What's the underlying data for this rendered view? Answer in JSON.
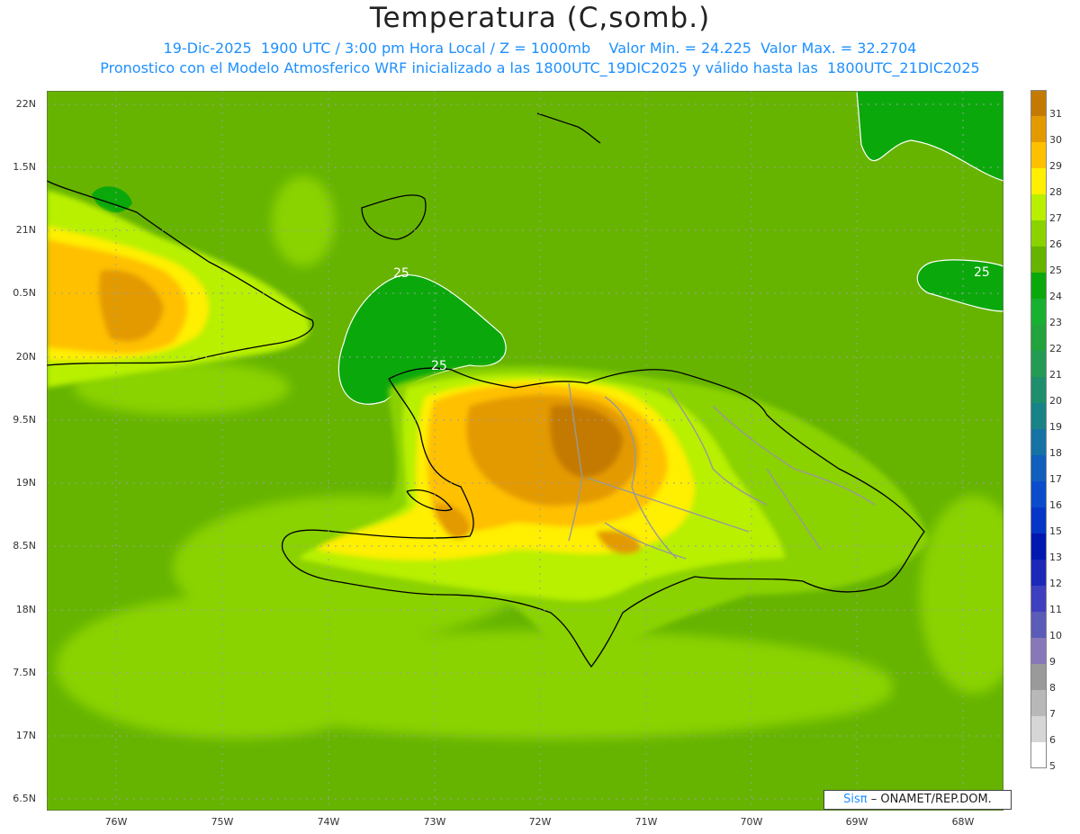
{
  "header": {
    "title": "Temperatura (C,somb.)",
    "subtitle_line1": "19-Dic-2025  1900 UTC / 3:00 pm Hora Local / Z = 1000mb    Valor Min. = 24.225  Valor Max. = 32.2704",
    "subtitle_line2": "Pronostico con el Modelo Atmosferico WRF inicializado a las 1800UTC_19DIC2025 y válido hasta las  1800UTC_21DIC2025"
  },
  "axes": {
    "y_labels": [
      "22N",
      "1.5N",
      "21N",
      "0.5N",
      "20N",
      "9.5N",
      "19N",
      "8.5N",
      "18N",
      "7.5N",
      "17N",
      "6.5N"
    ],
    "x_labels": [
      "76W",
      "75W",
      "74W",
      "73W",
      "72W",
      "71W",
      "70W",
      "69W",
      "68W"
    ]
  },
  "contour_labels": [
    "25",
    "25",
    "25"
  ],
  "colorbar": {
    "labels": [
      "31",
      "30",
      "29",
      "28",
      "27",
      "26",
      "25",
      "24",
      "23",
      "22",
      "21",
      "20",
      "19",
      "18",
      "17",
      "16",
      "15",
      "13",
      "12",
      "11",
      "10",
      "9",
      "8",
      "7",
      "6",
      "5"
    ],
    "colors": [
      "#c47a00",
      "#e39a00",
      "#ffc000",
      "#ffef00",
      "#b8f000",
      "#8ad200",
      "#66b400",
      "#0ba80b",
      "#18b030",
      "#22a33c",
      "#259a55",
      "#1f8e6d",
      "#198287",
      "#1572a5",
      "#105fbd",
      "#0b4ccc",
      "#0636c8",
      "#0018b0",
      "#1c28b8",
      "#3f40c0",
      "#5a5cb8",
      "#8878b8",
      "#9a9a9a",
      "#b8b8b8",
      "#d6d6d6",
      "#ffffff"
    ]
  },
  "credit": {
    "brand": "Sisπ",
    "text": "– ONAMET/REP.DOM."
  }
}
